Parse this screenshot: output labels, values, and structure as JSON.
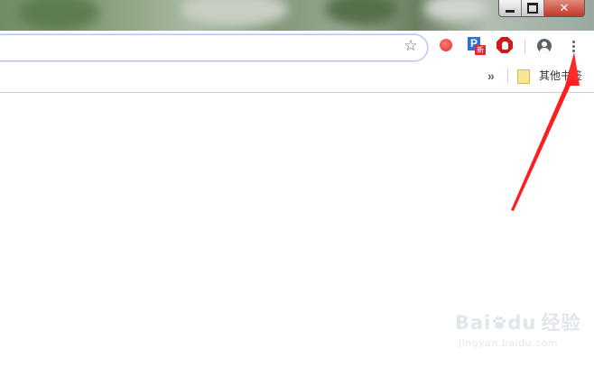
{
  "window": {
    "minimize_glyph": "minimize-icon",
    "maximize_glyph": "restore-icon",
    "close_label": "✕"
  },
  "toolbar": {
    "star_glyph": "☆",
    "extensions": [
      {
        "icon": "red-blob-extension-icon"
      },
      {
        "icon": "p-extension-icon",
        "letter": "P",
        "badge": "新"
      },
      {
        "icon": "stop-hand-extension-icon"
      }
    ],
    "profile_icon": "account-icon",
    "menu_icon": "three-dot-menu-icon"
  },
  "bookmarks_bar": {
    "overflow_glyph": "»",
    "folder_label": "其他书签"
  },
  "annotation": {
    "color": "#ff1e1e"
  },
  "watermark": {
    "brand": "Bai",
    "brand_suffix": "du",
    "product": "经验",
    "url": "jingyan.baidu.com"
  },
  "colors": {
    "omnibox_border": "#b9c8e6",
    "toolbar_icon": "#5f6368",
    "arrow": "#ff1e1e"
  }
}
